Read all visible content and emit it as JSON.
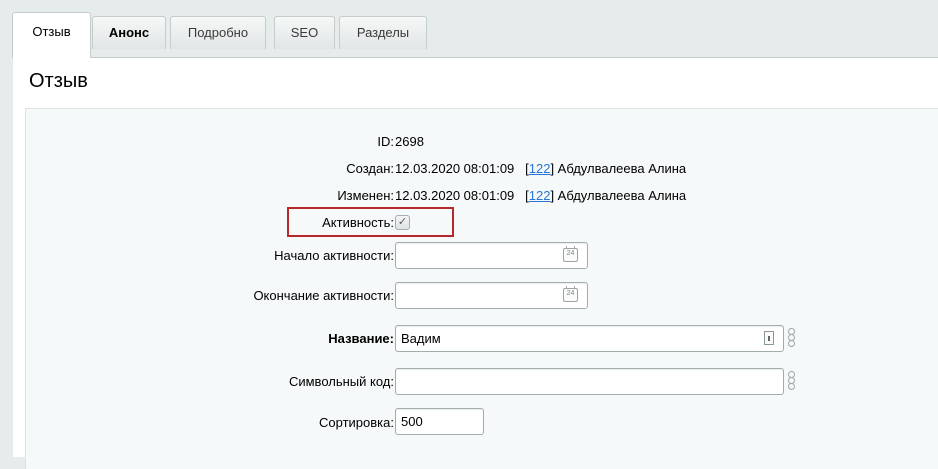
{
  "tabs": [
    {
      "label": "Отзыв"
    },
    {
      "label": "Анонс"
    },
    {
      "label": "Подробно"
    },
    {
      "label": "SEO"
    },
    {
      "label": "Разделы"
    }
  ],
  "section_title": "Отзыв",
  "fields": {
    "id": {
      "label": "ID:",
      "value": "2698"
    },
    "created": {
      "label": "Создан:",
      "date": "12.03.2020 08:01:09",
      "user_id": "122",
      "user_name": "Абдулвалеева Алина"
    },
    "modified": {
      "label": "Изменен:",
      "date": "12.03.2020 08:01:09",
      "user_id": "122",
      "user_name": "Абдулвалеева Алина"
    },
    "active": {
      "label": "Активность:",
      "checked": true
    },
    "active_from": {
      "label": "Начало активности:",
      "value": ""
    },
    "active_to": {
      "label": "Окончание активности:",
      "value": ""
    },
    "name": {
      "label": "Название:",
      "value": "Вадим"
    },
    "code": {
      "label": "Символьный код:",
      "value": ""
    },
    "sort": {
      "label": "Сортировка:",
      "value": "500"
    }
  },
  "icons": {
    "calendar": "calendar-icon",
    "text_editor": "text-editor-icon",
    "link": "link-icon",
    "checkmark": "✓"
  },
  "colors": {
    "background": "#e6ebeb",
    "form_background": "#f5f9f9",
    "link": "#2675d7",
    "highlight": "#b5292d"
  }
}
